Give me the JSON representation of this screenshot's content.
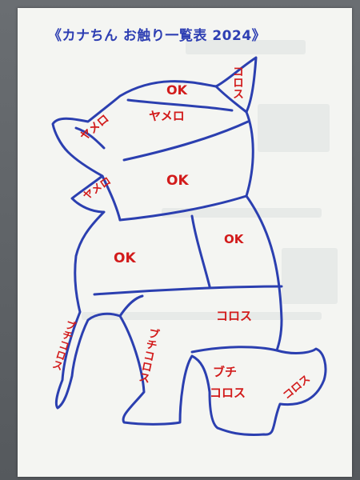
{
  "title": "《カナちん お触り一覧表 2024》",
  "colors": {
    "ink_blue": "#2b3fb0",
    "marker_red": "#d21b1b",
    "paper": "#f4f5f2"
  },
  "regions": {
    "top_head": "OK",
    "ear": "コロス",
    "muzzle": "ヤメロ",
    "head": "ヤメロ",
    "jaw": "ヤメロ",
    "neck": "OK",
    "back": "OK",
    "chest": "OK",
    "belly": "コロス",
    "front_left_leg": "ブチコロス",
    "front_right_leg": "ブチコロス",
    "hind_leg_1": "ブチ",
    "hind_leg_2": "コロス",
    "tail": "コロス"
  }
}
